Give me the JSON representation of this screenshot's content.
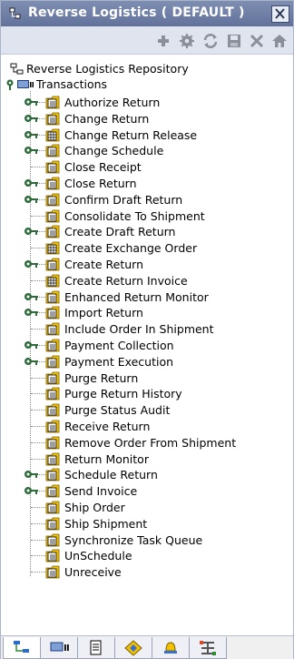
{
  "window": {
    "title": "Reverse Logistics ( DEFAULT )",
    "tree_icon": "tree-icon",
    "close_icon": "close-icon"
  },
  "toolbar": {
    "buttons": [
      {
        "name": "add-button",
        "icon": "plus-icon"
      },
      {
        "name": "details-button",
        "icon": "gear-icon"
      },
      {
        "name": "refresh-button",
        "icon": "refresh-icon"
      },
      {
        "name": "save-button",
        "icon": "save-icon"
      },
      {
        "name": "delete-button",
        "icon": "delete-icon"
      },
      {
        "name": "home-button",
        "icon": "home-icon"
      }
    ]
  },
  "tree": {
    "root": "Reverse Logistics Repository",
    "group": "Transactions",
    "items": [
      {
        "label": "Authorize Return",
        "expandable": true,
        "icon": "folder-doc-icon"
      },
      {
        "label": "Change Return",
        "expandable": true,
        "icon": "folder-doc-icon"
      },
      {
        "label": "Change Return Release",
        "expandable": true,
        "icon": "folder-grid-icon"
      },
      {
        "label": "Change Schedule",
        "expandable": true,
        "icon": "folder-doc-icon"
      },
      {
        "label": "Close Receipt",
        "expandable": false,
        "icon": "folder-doc-icon"
      },
      {
        "label": "Close Return",
        "expandable": true,
        "icon": "folder-doc-icon"
      },
      {
        "label": "Confirm Draft Return",
        "expandable": true,
        "icon": "folder-doc-icon"
      },
      {
        "label": "Consolidate To Shipment",
        "expandable": false,
        "icon": "folder-doc-icon"
      },
      {
        "label": "Create Draft Return",
        "expandable": true,
        "icon": "folder-doc-icon"
      },
      {
        "label": "Create Exchange Order",
        "expandable": false,
        "icon": "folder-grid-icon"
      },
      {
        "label": "Create Return",
        "expandable": true,
        "icon": "folder-doc-icon"
      },
      {
        "label": "Create Return Invoice",
        "expandable": false,
        "icon": "folder-grid-icon"
      },
      {
        "label": "Enhanced Return Monitor",
        "expandable": true,
        "icon": "folder-doc-icon"
      },
      {
        "label": "Import Return",
        "expandable": true,
        "icon": "folder-doc-icon"
      },
      {
        "label": "Include Order In Shipment",
        "expandable": false,
        "icon": "folder-doc-icon"
      },
      {
        "label": "Payment Collection",
        "expandable": true,
        "icon": "folder-doc-icon"
      },
      {
        "label": "Payment Execution",
        "expandable": true,
        "icon": "folder-doc-icon"
      },
      {
        "label": "Purge Return",
        "expandable": false,
        "icon": "folder-doc-icon"
      },
      {
        "label": "Purge Return History",
        "expandable": false,
        "icon": "folder-doc-icon"
      },
      {
        "label": "Purge Status Audit",
        "expandable": false,
        "icon": "folder-doc-icon"
      },
      {
        "label": "Receive Return",
        "expandable": false,
        "icon": "folder-doc-icon"
      },
      {
        "label": "Remove Order From Shipment",
        "expandable": false,
        "icon": "folder-doc-icon"
      },
      {
        "label": "Return Monitor",
        "expandable": false,
        "icon": "folder-doc-icon"
      },
      {
        "label": "Schedule Return",
        "expandable": true,
        "icon": "folder-doc-icon"
      },
      {
        "label": "Send Invoice",
        "expandable": true,
        "icon": "folder-doc-icon"
      },
      {
        "label": "Ship Order",
        "expandable": false,
        "icon": "folder-doc-icon"
      },
      {
        "label": "Ship Shipment",
        "expandable": false,
        "icon": "folder-doc-icon"
      },
      {
        "label": "Synchronize Task Queue",
        "expandable": false,
        "icon": "folder-doc-icon"
      },
      {
        "label": "UnSchedule",
        "expandable": false,
        "icon": "folder-doc-icon"
      },
      {
        "label": "Unreceive",
        "expandable": false,
        "icon": "folder-doc-icon"
      }
    ]
  },
  "bottom_tabs": [
    {
      "name": "tab-hierarchy",
      "icon": "hierarchy-icon",
      "active": true
    },
    {
      "name": "tab-transactions",
      "icon": "transactions-icon",
      "active": false
    },
    {
      "name": "tab-documents",
      "icon": "document-icon",
      "active": false
    },
    {
      "name": "tab-diamond",
      "icon": "diamond-icon",
      "active": false
    },
    {
      "name": "tab-alerts",
      "icon": "bell-icon",
      "active": false
    },
    {
      "name": "tab-network",
      "icon": "network-icon",
      "active": false
    }
  ],
  "colors": {
    "title_bar": "#6f7fa5",
    "toolbar_bg": "#dfe4ee",
    "folder_yellow": "#f2c200",
    "key_green": "#2e6b3a"
  }
}
